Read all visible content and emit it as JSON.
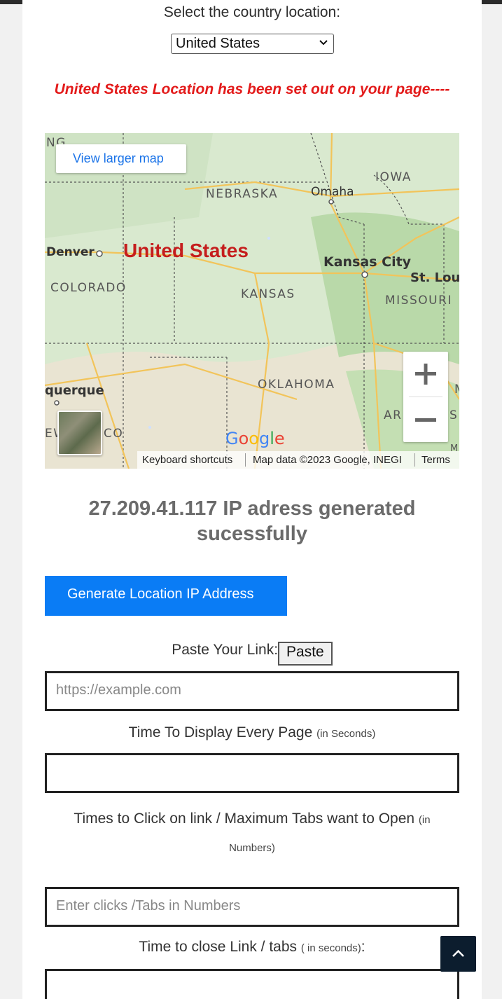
{
  "country_section": {
    "label": "Select the country location:",
    "selected_country": "United States"
  },
  "status_message": "United States Location has been set out on your page----",
  "map": {
    "view_larger_label": "View larger map",
    "country_label": "United States",
    "states": [
      "NEBRASKA",
      "IOWA",
      "COLORADO",
      "KANSAS",
      "MISSOURI",
      "OKLAHOMA"
    ],
    "cities": [
      "Omaha",
      "Denver",
      "Kansas City",
      "St. Lou",
      "querque"
    ],
    "fragments": [
      "NG",
      "AR",
      "EW",
      "CO",
      "M",
      "S",
      "M"
    ],
    "footer": {
      "shortcuts": "Keyboard shortcuts",
      "map_data": "Map data ©2023 Google, INEGI",
      "terms": "Terms"
    },
    "logo_text": "Google"
  },
  "ip_message": "27.209.41.117 IP adress generated sucessfully",
  "generate_button": "Generate Location IP Address",
  "paste": {
    "label": "Paste Your Link:",
    "button": "Paste",
    "placeholder": "https://example.com"
  },
  "time_display": {
    "label": "Time To Display Every Page",
    "unit": "(in Seconds)",
    "value": ""
  },
  "clicks": {
    "label": "Times to Click on link / Maximum Tabs want to Open",
    "unit": "(in Numbers)",
    "placeholder": "Enter clicks /Tabs in Numbers"
  },
  "close_time": {
    "label": "Time to close Link / tabs",
    "unit": "( in seconds)",
    "suffix": ":",
    "value": ""
  },
  "colors": {
    "accent_button": "#0a7cf5",
    "status_red": "#e31b1b",
    "scroll_top_bg": "#0c1d2e"
  }
}
